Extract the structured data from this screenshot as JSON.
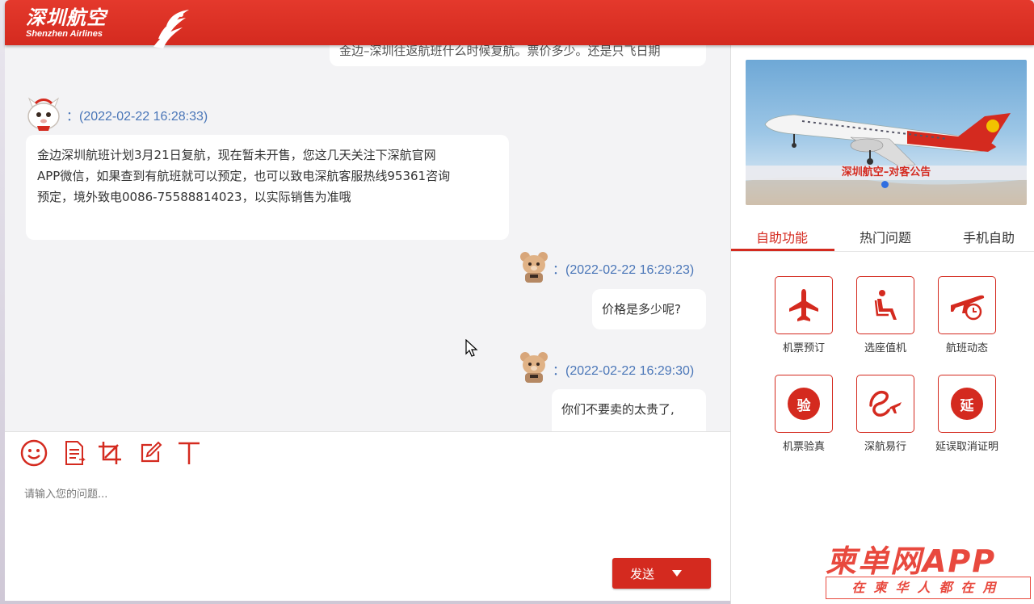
{
  "header": {
    "brand_cn": "深圳航空",
    "brand_en": "Shenzhen Airlines",
    "color": "#d42a1f"
  },
  "chat": {
    "partial_top_message": "金边–深圳往返航班什么时候复航。票价多少。还是只飞日期",
    "messages": [
      {
        "sender": "agent",
        "avatar": "mascot-avatar",
        "time": "：(2022-02-22 16:28:33)",
        "text_lines": [
          "金边深圳航班计划3月21日复航，现在暂未开售，您这几天关注下深航官网",
          "APP微信，如果查到有航班就可以预定，也可以致电深航客服热线95361咨询",
          "预定，境外致电0086-75588814023，以实际销售为准哦"
        ]
      },
      {
        "sender": "user",
        "avatar": "bear-avatar",
        "time": "：(2022-02-22 16:29:23)",
        "text": "价格是多少呢?"
      },
      {
        "sender": "user",
        "avatar": "bear-avatar",
        "time": "：(2022-02-22 16:29:30)",
        "text": "你们不要卖的太贵了,"
      }
    ]
  },
  "input": {
    "toolbar_icons": [
      "emoji-icon",
      "file-icon",
      "crop-icon",
      "edit-icon",
      "text-icon"
    ],
    "placeholder": "请输入您的问题...",
    "send_label": "发送"
  },
  "sidebar": {
    "banner_caption": "深圳航空–对客公告",
    "tabs": [
      {
        "label": "自助功能",
        "active": true
      },
      {
        "label": "热门问题",
        "active": false
      },
      {
        "label": "手机自助",
        "active": false
      }
    ],
    "functions": [
      {
        "label": "机票预订",
        "icon": "plane-icon"
      },
      {
        "label": "选座值机",
        "icon": "seat-icon"
      },
      {
        "label": "航班动态",
        "icon": "flight-status-icon"
      },
      {
        "label": "机票验真",
        "icon": "verify-icon",
        "glyph": "验"
      },
      {
        "label": "深航易行",
        "icon": "easy-travel-icon"
      },
      {
        "label": "延误取消证明",
        "icon": "delay-certificate-icon",
        "glyph": "延"
      }
    ]
  },
  "watermark": {
    "top": "柬单网APP",
    "bottom": "在柬华人都在用"
  }
}
